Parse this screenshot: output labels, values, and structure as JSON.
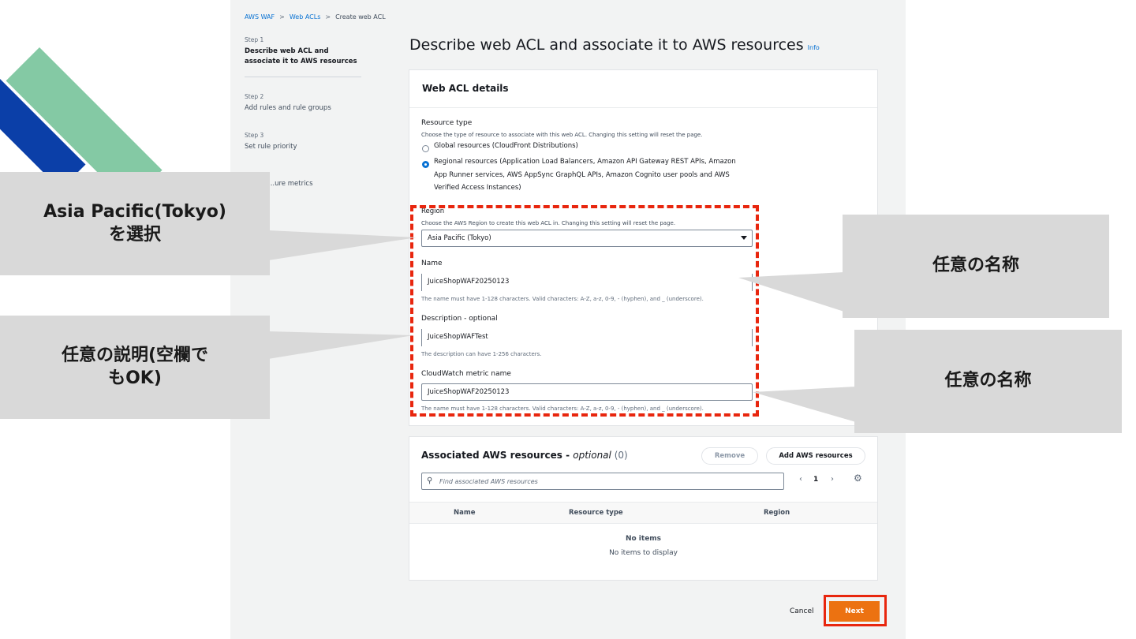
{
  "breadcrumb": [
    "AWS WAF",
    "Web ACLs",
    "Create web ACL"
  ],
  "steps": [
    {
      "num": "Step 1",
      "title": "Describe web ACL and associate it to AWS resources"
    },
    {
      "num": "Step 2",
      "title": "Add rules and rule groups"
    },
    {
      "num": "Step 3",
      "title": "Set rule priority"
    },
    {
      "num": "",
      "title": "...ure metrics"
    }
  ],
  "page": {
    "title": "Describe web ACL and associate it to AWS resources",
    "info": "Info"
  },
  "details": {
    "header": "Web ACL details",
    "resource_type": {
      "label": "Resource type",
      "desc": "Choose the type of resource to associate with this web ACL. Changing this setting will reset the page.",
      "options": [
        "Global resources (CloudFront Distributions)",
        "Regional resources (Application Load Balancers, Amazon API Gateway REST APIs, Amazon App Runner services, AWS AppSync GraphQL APIs, Amazon Cognito user pools and AWS Verified Access Instances)"
      ]
    },
    "region": {
      "label": "Region",
      "desc": "Choose the AWS Region to create this web ACL in. Changing this setting will reset the page.",
      "value": "Asia Pacific (Tokyo)"
    },
    "name": {
      "label": "Name",
      "value": "JuiceShopWAF20250123",
      "hint": "The name must have 1-128 characters. Valid characters: A-Z, a-z, 0-9, - (hyphen), and _ (underscore)."
    },
    "description": {
      "label": "Description - optional",
      "value": "JuiceShopWAFTest",
      "hint": "The description can have 1-256 characters."
    },
    "metric": {
      "label": "CloudWatch metric name",
      "value": "JuiceShopWAF20250123",
      "hint": "The name must have 1-128 characters. Valid characters: A-Z, a-z, 0-9, - (hyphen), and _ (underscore)."
    }
  },
  "resources": {
    "title": "Associated AWS resources - ",
    "optional": "optional",
    "count": " (0)",
    "remove_label": "Remove",
    "add_label": "Add AWS resources",
    "search_placeholder": "Find associated AWS resources",
    "page_number": "1",
    "columns": [
      "Name",
      "Resource type",
      "Region"
    ],
    "empty_title": "No items",
    "empty_desc": "No items to display"
  },
  "footer": {
    "cancel_label": "Cancel",
    "next_label": "Next"
  },
  "callouts": {
    "region": "Asia Pacific(Tokyo)\nを選択",
    "description": "任意の説明(空欄で\nもOK)",
    "name": "任意の名称",
    "metric": "任意の名称"
  },
  "colors": {
    "accent": "#0972d3",
    "highlight": "#e8260e",
    "next": "#ec7211",
    "callout_bg": "#d9d9d9"
  }
}
